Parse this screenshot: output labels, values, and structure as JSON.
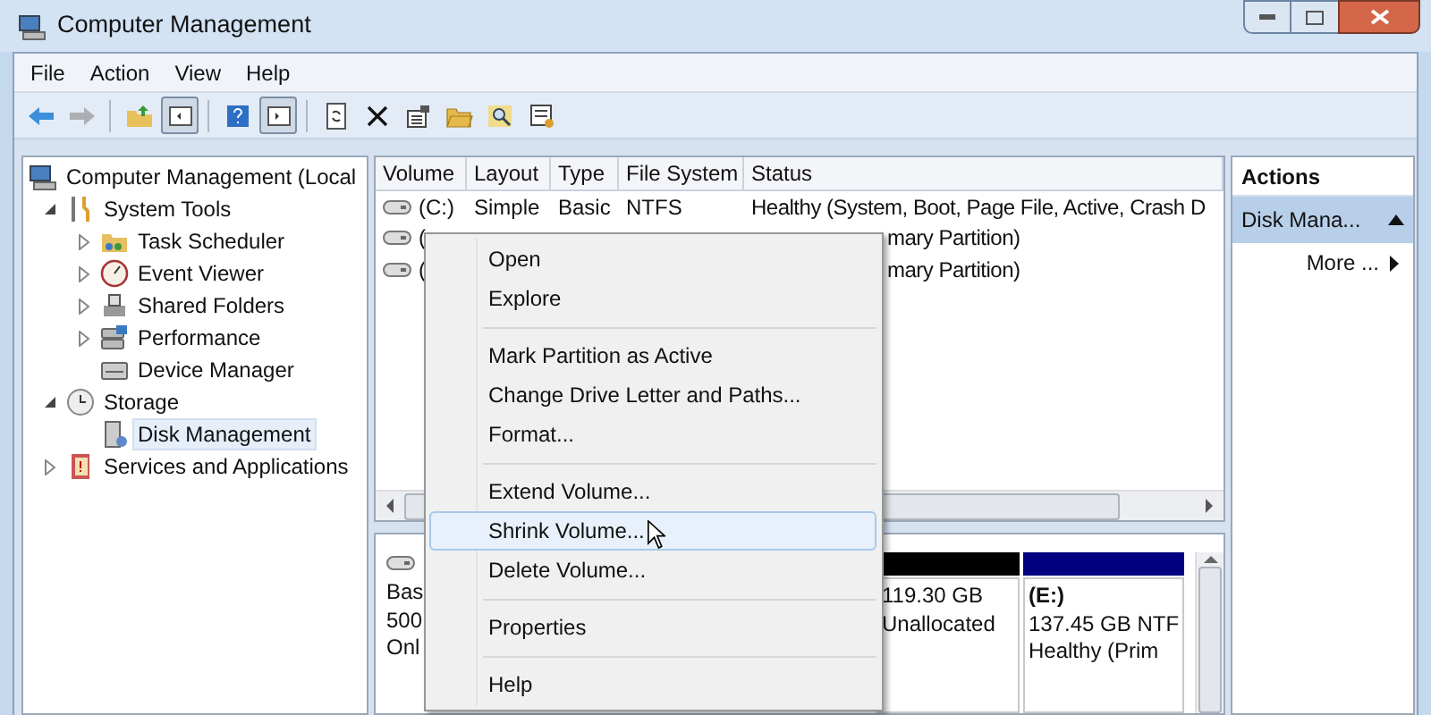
{
  "window": {
    "title": "Computer Management"
  },
  "menu_bar": [
    "File",
    "Action",
    "View",
    "Help"
  ],
  "toolbar": [
    {
      "disabled": false,
      "pressed": false
    },
    {
      "disabled": true,
      "pressed": false
    },
    {
      "disabled": false,
      "pressed": false
    },
    {
      "disabled": false,
      "pressed": true
    },
    {
      "disabled": false,
      "pressed": false
    },
    {
      "disabled": false,
      "pressed": true
    },
    {
      "disabled": false,
      "pressed": false
    },
    {
      "disabled": false,
      "pressed": false
    },
    {
      "disabled": false,
      "pressed": false
    },
    {
      "disabled": false,
      "pressed": false
    },
    {
      "disabled": false,
      "pressed": false
    },
    {
      "disabled": false,
      "pressed": false
    }
  ],
  "tree": [
    {
      "label": "Computer Management (Local",
      "selected": false,
      "children": [
        {
          "label": "System Tools",
          "expanded": true,
          "selected": false,
          "children": [
            {
              "label": "Task Scheduler",
              "expanded": false,
              "selected": false
            },
            {
              "label": "Event Viewer",
              "expanded": false,
              "selected": false
            },
            {
              "label": "Shared Folders",
              "expanded": false,
              "selected": false
            },
            {
              "label": "Performance",
              "expanded": false,
              "selected": false
            },
            {
              "label": "Device Manager",
              "selected": false
            }
          ]
        },
        {
          "label": "Storage",
          "expanded": true,
          "selected": false,
          "children": [
            {
              "label": "Disk Management",
              "selected": true
            }
          ]
        },
        {
          "label": "Services and Applications",
          "expanded": false,
          "selected": false
        }
      ]
    }
  ],
  "volume_list": {
    "columns": [
      "Volume",
      "Layout",
      "Type",
      "File System",
      "Status"
    ],
    "rows": [
      {
        "cells": [
          "(C:)",
          "Simple",
          "Basic",
          "NTFS",
          "Healthy (System, Boot, Page File, Active, Crash D"
        ]
      },
      {
        "cells": [
          "(",
          "",
          "",
          "",
          "mary Partition)"
        ]
      },
      {
        "cells": [
          "(",
          "",
          "",
          "",
          "mary Partition)"
        ]
      }
    ]
  },
  "disk_pane": {
    "disk_info": [
      "Bas",
      "500",
      "Onl"
    ],
    "partitions": [
      {
        "color": "#000000",
        "lines": [
          "119.30 GB",
          "Unallocated"
        ]
      },
      {
        "color": "#000080",
        "lines": [
          "(E:)",
          "137.45 GB NTF",
          "Healthy (Prim"
        ]
      }
    ]
  },
  "actions": {
    "title": "Actions",
    "items": [
      {
        "label": "Disk Mana...",
        "kind": "header"
      },
      {
        "label": "More ...",
        "kind": "submenu"
      }
    ]
  },
  "context_menu": [
    {
      "kind": "item",
      "label": "Open",
      "selected": false
    },
    {
      "kind": "item",
      "label": "Explore",
      "selected": false
    },
    {
      "kind": "separator"
    },
    {
      "kind": "item",
      "label": "Mark Partition as Active",
      "selected": false
    },
    {
      "kind": "item",
      "label": "Change Drive Letter and Paths...",
      "selected": false
    },
    {
      "kind": "item",
      "label": "Format...",
      "selected": false
    },
    {
      "kind": "separator"
    },
    {
      "kind": "item",
      "label": "Extend Volume...",
      "selected": false
    },
    {
      "kind": "item",
      "label": "Shrink Volume...",
      "selected": true
    },
    {
      "kind": "item",
      "label": "Delete Volume...",
      "selected": false
    },
    {
      "kind": "separator"
    },
    {
      "kind": "item",
      "label": "Properties",
      "selected": false
    },
    {
      "kind": "separator"
    },
    {
      "kind": "item",
      "label": "Help",
      "selected": false
    }
  ]
}
